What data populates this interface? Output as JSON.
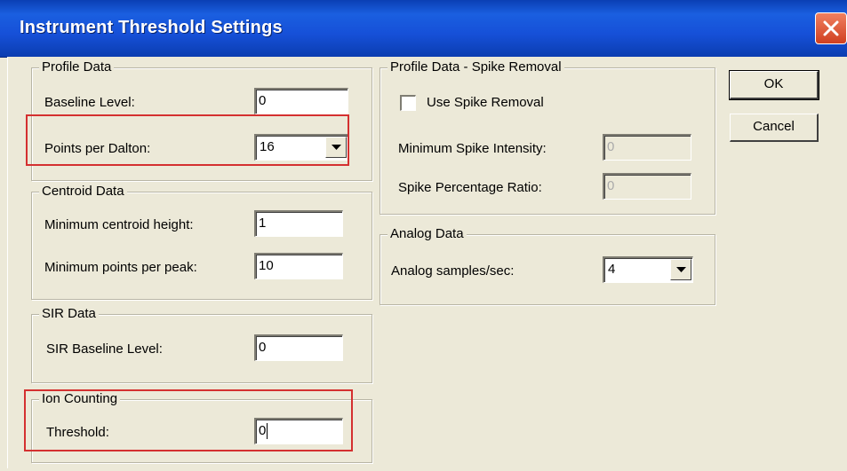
{
  "window": {
    "title": "Instrument Threshold Settings"
  },
  "buttons": {
    "ok": "OK",
    "cancel": "Cancel"
  },
  "profile_data": {
    "legend": "Profile Data",
    "baseline_label": "Baseline Level:",
    "baseline_value": "0",
    "ppd_label": "Points per Dalton:",
    "ppd_value": "16"
  },
  "centroid_data": {
    "legend": "Centroid Data",
    "min_height_label": "Minimum centroid height:",
    "min_height_value": "1",
    "min_points_label": "Minimum points per peak:",
    "min_points_value": "10"
  },
  "sir_data": {
    "legend": "SIR Data",
    "baseline_label": "SIR Baseline Level:",
    "baseline_value": "0"
  },
  "ion_counting": {
    "legend": "Ion Counting",
    "threshold_label": "Threshold:",
    "threshold_value": "0"
  },
  "spike_removal": {
    "legend": "Profile Data - Spike Removal",
    "use_label": "Use Spike Removal",
    "use_checked": false,
    "min_intensity_label": "Minimum Spike Intensity:",
    "min_intensity_value": "0",
    "ratio_label": "Spike Percentage Ratio:",
    "ratio_value": "0"
  },
  "analog_data": {
    "legend": "Analog Data",
    "samples_label": "Analog samples/sec:",
    "samples_value": "4"
  },
  "colors": {
    "titlebar": "#1650d8",
    "highlight": "#d43030",
    "dialog": "#ece9d8"
  }
}
